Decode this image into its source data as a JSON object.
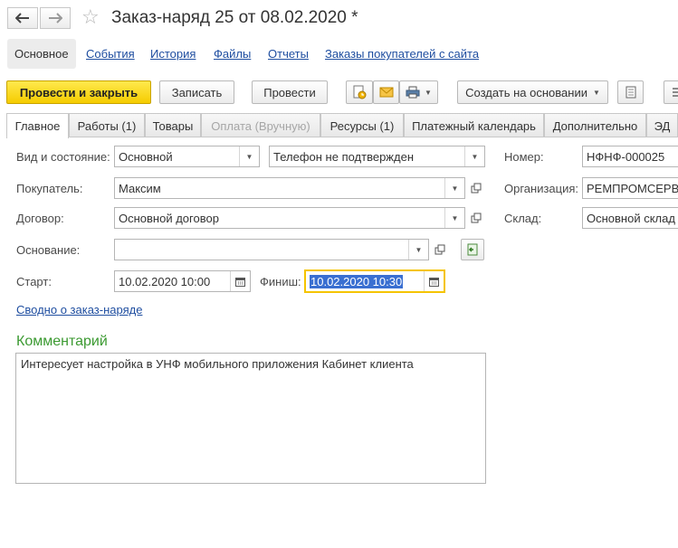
{
  "window": {
    "title": "Заказ-наряд 25 от 08.02.2020 *"
  },
  "nav": {
    "back_icon": "arrow-left-icon",
    "forward_icon": "arrow-right-icon",
    "favorite_icon": "star-icon"
  },
  "sections": [
    {
      "label": "Основное",
      "active": true
    },
    {
      "label": "События"
    },
    {
      "label": "История"
    },
    {
      "label": "Файлы"
    },
    {
      "label": "Отчеты"
    },
    {
      "label": "Заказы покупателей с сайта"
    }
  ],
  "toolbar": {
    "post_close": "Провести и закрыть",
    "save": "Записать",
    "post": "Провести",
    "create_based": "Создать на основании"
  },
  "tabs": [
    {
      "label": "Главное",
      "active": true
    },
    {
      "label": "Работы (1)"
    },
    {
      "label": "Товары"
    },
    {
      "label": "Оплата (Вручную)",
      "disabled": true
    },
    {
      "label": "Ресурсы (1)"
    },
    {
      "label": "Платежный календарь"
    },
    {
      "label": "Дополнительно"
    },
    {
      "label": "ЭД"
    }
  ],
  "form": {
    "kind_label": "Вид и состояние:",
    "kind_value": "Основной",
    "state_value": "Телефон не подтвержден",
    "buyer_label": "Покупатель:",
    "buyer_value": "Максим",
    "contract_label": "Договор:",
    "contract_value": "Основной договор",
    "basis_label": "Основание:",
    "basis_value": "",
    "start_label": "Старт:",
    "start_value": "10.02.2020 10:00",
    "finish_label": "Финиш:",
    "finish_value": "10.02.2020 10:30",
    "summary_link": "Сводно о заказ-наряде",
    "number_label": "Номер:",
    "number_value": "НФНФ-000025",
    "org_label": "Организация:",
    "org_value": "РЕМПРОМСЕРВ",
    "warehouse_label": "Склад:",
    "warehouse_value": "Основной склад"
  },
  "comment": {
    "title": "Комментарий",
    "text": "Интересует настройка в УНФ мобильного приложения Кабинет клиента"
  },
  "colors": {
    "primary_button": "#f5cc00",
    "link": "#1f4ea0",
    "group_title": "#3c9a32",
    "focus_border": "#f5c400",
    "selection": "#3a6fd1"
  }
}
